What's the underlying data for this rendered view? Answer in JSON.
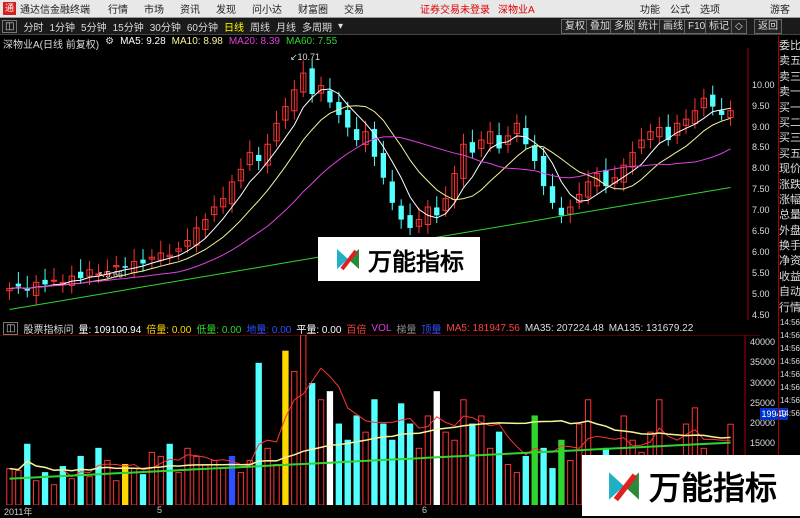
{
  "titlebar": {
    "app_title": "通达信金融终端",
    "menus": [
      "行情",
      "市场",
      "资讯",
      "发现",
      "问小达",
      "财富圈",
      "交易"
    ],
    "status": "证券交易未登录",
    "stock": "深物业A",
    "right_menus": [
      "功能",
      "公式",
      "选项"
    ],
    "user": "游客"
  },
  "toolbar": {
    "timeframes": [
      "分时",
      "1分钟",
      "5分钟",
      "15分钟",
      "30分钟",
      "60分钟",
      "日线",
      "周线",
      "月线",
      "多周期"
    ],
    "active": "日线",
    "buttons": [
      "复权",
      "叠加",
      "多股",
      "统计",
      "画线",
      "F10",
      "标记",
      "◇",
      "返回"
    ]
  },
  "kline_info": {
    "name": "深物业A(日线 前复权)",
    "ma5": "MA5: 9.28",
    "ma10": "MA10: 8.98",
    "ma20": "MA20: 8.39",
    "ma60": "MA60: 7.55"
  },
  "price_axis": [
    "10.00",
    "9.50",
    "9.00",
    "8.50",
    "8.00",
    "7.50",
    "7.00",
    "6.50",
    "6.00",
    "5.50",
    "5.00",
    "4.50"
  ],
  "annotations": {
    "high": "10.71",
    "low": "5.66"
  },
  "right_panel": [
    "委比",
    "卖五",
    "卖三",
    "卖一",
    "买一",
    "买二",
    "买三",
    "买五",
    "现价",
    "涨跌",
    "涨幅",
    "总量",
    "外盘",
    "换手",
    "净资",
    "收益",
    "自动",
    "行情",
    "14:56",
    "14:56",
    "14:56",
    "14:56",
    "14:56",
    "14:56",
    "14:56",
    "14:56"
  ],
  "vol_info": {
    "title": "股票指标问",
    "items": [
      "量: 109100.94",
      "倍量: 0.00",
      "低量: 0.00",
      "地量: 0.00",
      "平量: 0.00",
      "百倍",
      "VOL",
      "梯量",
      "顶量",
      "MA5: 181947.56",
      "MA35: 207224.48",
      "MA135: 131679.22"
    ]
  },
  "vol_axis": [
    "40000",
    "35000",
    "30000",
    "25000",
    "20000",
    "15000"
  ],
  "current_vol": "19949",
  "dates": [
    "2011年",
    "5",
    "6"
  ],
  "watermark": "万能指标",
  "colors": {
    "up": "#ff3333",
    "down": "#54ffff",
    "ma5": "#ffffff",
    "ma10": "#f5f59a",
    "ma20": "#e040e0",
    "ma60": "#2fd62f"
  }
}
